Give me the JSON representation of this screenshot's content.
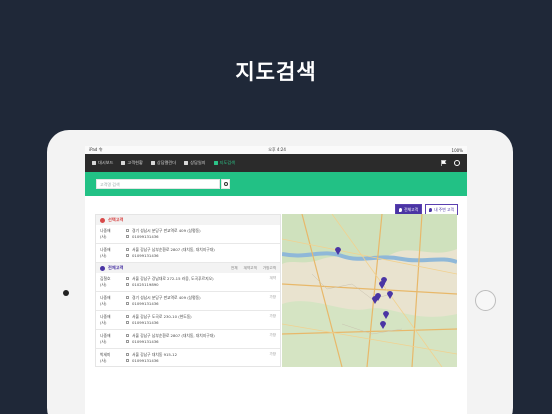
{
  "headline": "지도검색",
  "status": {
    "left": "iPad 令",
    "time": "오후 4:24",
    "right": "100%"
  },
  "nav": {
    "items": [
      {
        "label": "대시보드",
        "icon": "folder-icon"
      },
      {
        "label": "고객현황",
        "icon": "user-icon"
      },
      {
        "label": "상담캘린더",
        "icon": "calendar-icon"
      },
      {
        "label": "상담일지",
        "icon": "journal-icon"
      },
      {
        "label": "지도검색",
        "icon": "map-pin-icon",
        "active": true
      }
    ]
  },
  "search": {
    "placeholder": "고객명 검색"
  },
  "toggles": {
    "all": "전체고객",
    "mine": "내 주변 고객"
  },
  "section_a": {
    "title": "선택고객"
  },
  "section_b": {
    "title": "전체고객",
    "filters": [
      "전체",
      "계약고객",
      "가망고객"
    ]
  },
  "selected_rows": [
    {
      "name": "나중애",
      "grade": "(사)",
      "address": "경기 성남시 분당구 판교역로 409 (상평동)",
      "phone": "01099131436",
      "tag": ""
    },
    {
      "name": "나중애",
      "grade": "(사)",
      "address": "서울 강남구 남부순환로 2807 (대치동, 대치지구대)",
      "phone": "01099131436",
      "tag": ""
    }
  ],
  "all_rows": [
    {
      "name": "김철호",
      "grade": "(사)",
      "address": "서울 강남구 강남대로 272-15 러웅, 도곡푸르지오)",
      "phone": "01025119890",
      "tag": "계약"
    },
    {
      "name": "나중애",
      "grade": "(사)",
      "address": "경기 성남시 분당구 판교역로 409 (상평동)",
      "phone": "01099131436",
      "tag": "가망"
    },
    {
      "name": "나중애",
      "grade": "(사)",
      "address": "서울 강남구 도곡로 230-10 (현도동)",
      "phone": "01099131436",
      "tag": "가망"
    },
    {
      "name": "나중애",
      "grade": "(사)",
      "address": "서울 강남구 남부순환로 2807 (대치동, 대치지구대)",
      "phone": "01099131436",
      "tag": "가망"
    },
    {
      "name": "박세미",
      "grade": "(사)",
      "address": "서울 강남구 대치동 915-12",
      "phone": "01099131436",
      "tag": "가망"
    }
  ],
  "map": {
    "pin_color": "#4a35a4",
    "pin_count": 8
  }
}
